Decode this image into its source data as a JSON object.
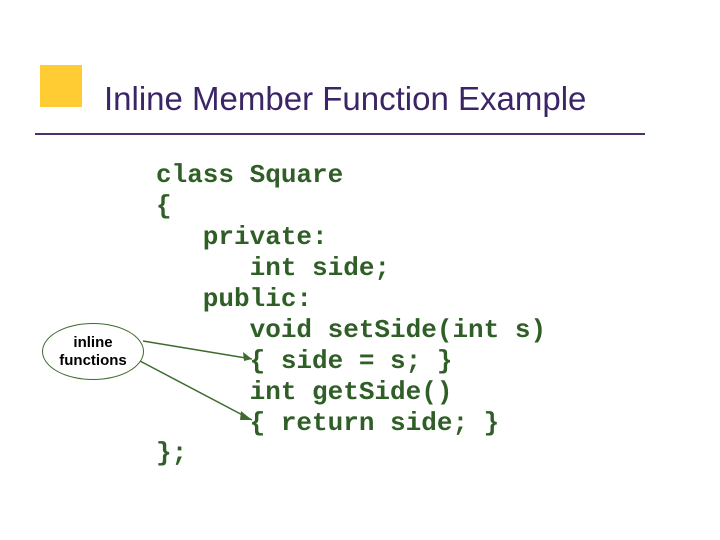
{
  "title": "Inline Member Function Example",
  "annotation": {
    "line1": "inline",
    "line2": "functions"
  },
  "code": {
    "l1": "class Square",
    "l2": "{",
    "l3": "   private:",
    "l4": "      int side;",
    "l5": "   public:",
    "l6": "      void setSide(int s)",
    "l7": "      { side = s; }",
    "l8": "      int getSide()",
    "l9": "      { return side; }",
    "l10": "};"
  }
}
